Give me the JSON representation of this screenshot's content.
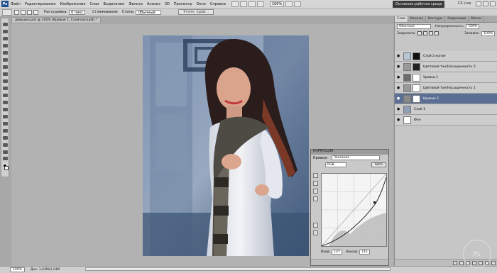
{
  "menubar": {
    "logo": "Ps",
    "items": [
      "Файл",
      "Редактирование",
      "Изображение",
      "Слои",
      "Выделение",
      "Фильтр",
      "Анализ",
      "3D",
      "Просмотр",
      "Окно",
      "Справка"
    ],
    "zoom": "100%",
    "workspace_button": "Основная рабочая среда",
    "cs_live": "CS Live"
  },
  "options": {
    "feather_label": "Растушевка:",
    "feather_value": "0 пикс",
    "antialias_label": "Сглаживание",
    "style_label": "Стиль:",
    "style_value": "Обычный",
    "refine_button": "Уточн. край..."
  },
  "document": {
    "tab_title": "девушка.psd @ 100% (Кривые 1, Слой-маска/8) *"
  },
  "layers_panel": {
    "tabs": [
      "Слои",
      "Каналы",
      "Контуры",
      "Коррекция",
      "Маски"
    ],
    "blend_mode": "Обычные",
    "opacity_label": "Непрозрачность:",
    "opacity_value": "100%",
    "lock_label": "Закрепить:",
    "fill_label": "Заливка:",
    "fill_value": "100%",
    "layers": [
      {
        "name": "Слой 2 копия",
        "selected": false
      },
      {
        "name": "Цветовой тон/Насыщенность 2",
        "selected": false
      },
      {
        "name": "Уровни 1",
        "selected": false
      },
      {
        "name": "Цветовой тон/Насыщенность 1",
        "selected": false
      },
      {
        "name": "Кривые 1",
        "selected": true
      },
      {
        "name": "Слой 1",
        "selected": false
      },
      {
        "name": "Фон",
        "selected": false
      }
    ]
  },
  "curves_panel": {
    "title": "КОРРЕКЦИЯ",
    "name": "Кривые",
    "preset": "Заказная",
    "channel": "RGB",
    "auto_button": "Авто",
    "input_label": "Вход:",
    "input_value": "127",
    "output_label": "Выход:",
    "output_value": "111"
  },
  "statusbar": {
    "zoom": "100%",
    "doc_info": "Док: 1,03М/3,14М"
  },
  "colors": {
    "selected_layer": "#5b6f94",
    "workspace_bg": "#b2b2b2",
    "panel_bg": "#c6c6c6"
  },
  "watermark": "Ps"
}
